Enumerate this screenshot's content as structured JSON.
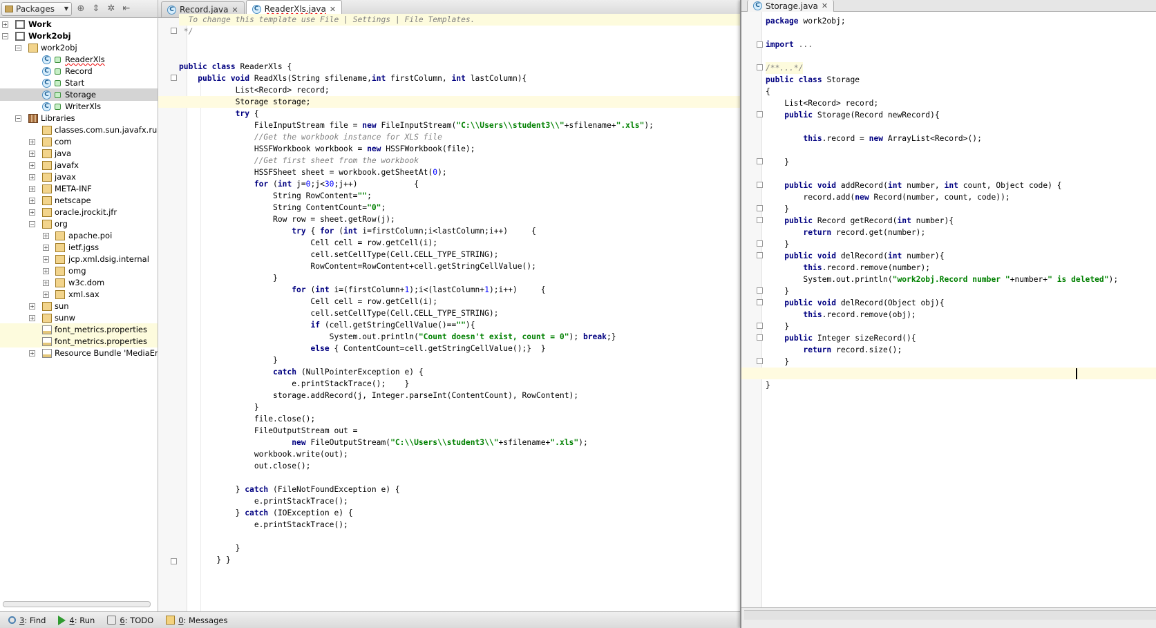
{
  "sidebar": {
    "view_combo": "Packages",
    "toolbar_icons": [
      "sync-icon",
      "collapse-icon",
      "settings-icon",
      "hide-icon"
    ],
    "tree": [
      {
        "label": "Work",
        "bold": true
      },
      {
        "label": "Work2obj",
        "bold": true
      },
      {
        "label": "work2obj"
      },
      {
        "label": "ReaderXls"
      },
      {
        "label": "Record"
      },
      {
        "label": "Start"
      },
      {
        "label": "Storage"
      },
      {
        "label": "WriterXls"
      },
      {
        "label": "Libraries"
      },
      {
        "label": "classes.com.sun.javafx.runtime"
      },
      {
        "label": "com"
      },
      {
        "label": "java"
      },
      {
        "label": "javafx"
      },
      {
        "label": "javax"
      },
      {
        "label": "META-INF"
      },
      {
        "label": "netscape"
      },
      {
        "label": "oracle.jrockit.jfr"
      },
      {
        "label": "org"
      },
      {
        "label": "apache.poi"
      },
      {
        "label": "ietf.jgss"
      },
      {
        "label": "jcp.xml.dsig.internal"
      },
      {
        "label": "omg"
      },
      {
        "label": "w3c.dom"
      },
      {
        "label": "xml.sax"
      },
      {
        "label": "sun"
      },
      {
        "label": "sunw"
      },
      {
        "label": "font_metrics.properties"
      },
      {
        "label": "font_metrics.properties"
      },
      {
        "label": "Resource Bundle 'MediaErrors'"
      }
    ]
  },
  "editor_left": {
    "tabs": [
      {
        "label": "Record.java",
        "active": false
      },
      {
        "label": "ReaderXls.java",
        "active": true
      }
    ],
    "lines": [
      "  To change this template use File | Settings | File Templates.",
      " */",
      "",
      "",
      "public class ReaderXls {",
      "    public void ReadXls(String sfilename,int firstColumn, int lastColumn){",
      "            List<Record> record;",
      "            Storage storage;",
      "            try {",
      "                FileInputStream file = new FileInputStream(\"C:\\\\Users\\\\student3\\\\\"+sfilename+\".xls\");",
      "                //Get the workbook instance for XLS file",
      "                HSSFWorkbook workbook = new HSSFWorkbook(file);",
      "                //Get first sheet from the workbook",
      "                HSSFSheet sheet = workbook.getSheetAt(0);",
      "                for (int j=0;j<30;j++)            {",
      "                    String RowContent=\"\";",
      "                    String ContentCount=\"0\";",
      "                    Row row = sheet.getRow(j);",
      "                        try { for (int i=firstColumn;i<lastColumn;i++)     {",
      "                            Cell cell = row.getCell(i);",
      "                            cell.setCellType(Cell.CELL_TYPE_STRING);",
      "                            RowContent=RowContent+cell.getStringCellValue();",
      "                    }",
      "                        for (int i=(firstColumn+1);i<(lastColumn+1);i++)     {",
      "                            Cell cell = row.getCell(i);",
      "                            cell.setCellType(Cell.CELL_TYPE_STRING);",
      "                            if (cell.getStringCellValue()==\"\"){",
      "                                System.out.println(\"Count doesn't exist, count = 0\"); break;}",
      "                            else { ContentCount=cell.getStringCellValue();}  }",
      "                    }",
      "                    catch (NullPointerException e) {",
      "                        e.printStackTrace();    }",
      "                    storage.addRecord(j, Integer.parseInt(ContentCount), RowContent);",
      "                }",
      "                file.close();",
      "                FileOutputStream out =",
      "                        new FileOutputStream(\"C:\\\\Users\\\\student3\\\\\"+sfilename+\".xls\");",
      "                workbook.write(out);",
      "                out.close();",
      "",
      "            } catch (FileNotFoundException e) {",
      "                e.printStackTrace();",
      "            } catch (IOException e) {",
      "                e.printStackTrace();",
      "",
      "            }",
      "        } }"
    ]
  },
  "editor_right": {
    "tabs": [
      {
        "label": "Storage.java",
        "active": true
      }
    ],
    "lines": [
      "package work2obj;",
      "",
      "import ...",
      "",
      "/**...*/",
      "public class Storage",
      "{",
      "    List<Record> record;",
      "    public Storage(Record newRecord){",
      "",
      "        this.record = new ArrayList<Record>();",
      "",
      "    }",
      "",
      "    public void addRecord(int number, int count, Object code) {",
      "        record.add(new Record(number, count, code));",
      "    }",
      "    public Record getRecord(int number){",
      "        return record.get(number);",
      "    }",
      "    public void delRecord(int number){",
      "        this.record.remove(number);",
      "        System.out.println(\"work2obj.Record number \"+number+\" is deleted\");",
      "    }",
      "    public void delRecord(Object obj){",
      "        this.record.remove(obj);",
      "    }",
      "    public Integer sizeRecord(){",
      "        return record.size();",
      "    }",
      "",
      "}"
    ]
  },
  "bottom_bar": [
    {
      "mnemonic": "3",
      "label": ": Find",
      "icon": "find-icon"
    },
    {
      "mnemonic": "4",
      "label": ": Run",
      "icon": "run-icon"
    },
    {
      "mnemonic": "6",
      "label": ": TODO",
      "icon": "todo-icon"
    },
    {
      "mnemonic": "0",
      "label": ": Messages",
      "icon": "messages-icon"
    }
  ],
  "colors": {
    "keyword": "#000080",
    "string": "#008000",
    "comment": "#808080",
    "field": "#660e7a",
    "number": "#0000ff",
    "selection": "#d4d4d4"
  }
}
